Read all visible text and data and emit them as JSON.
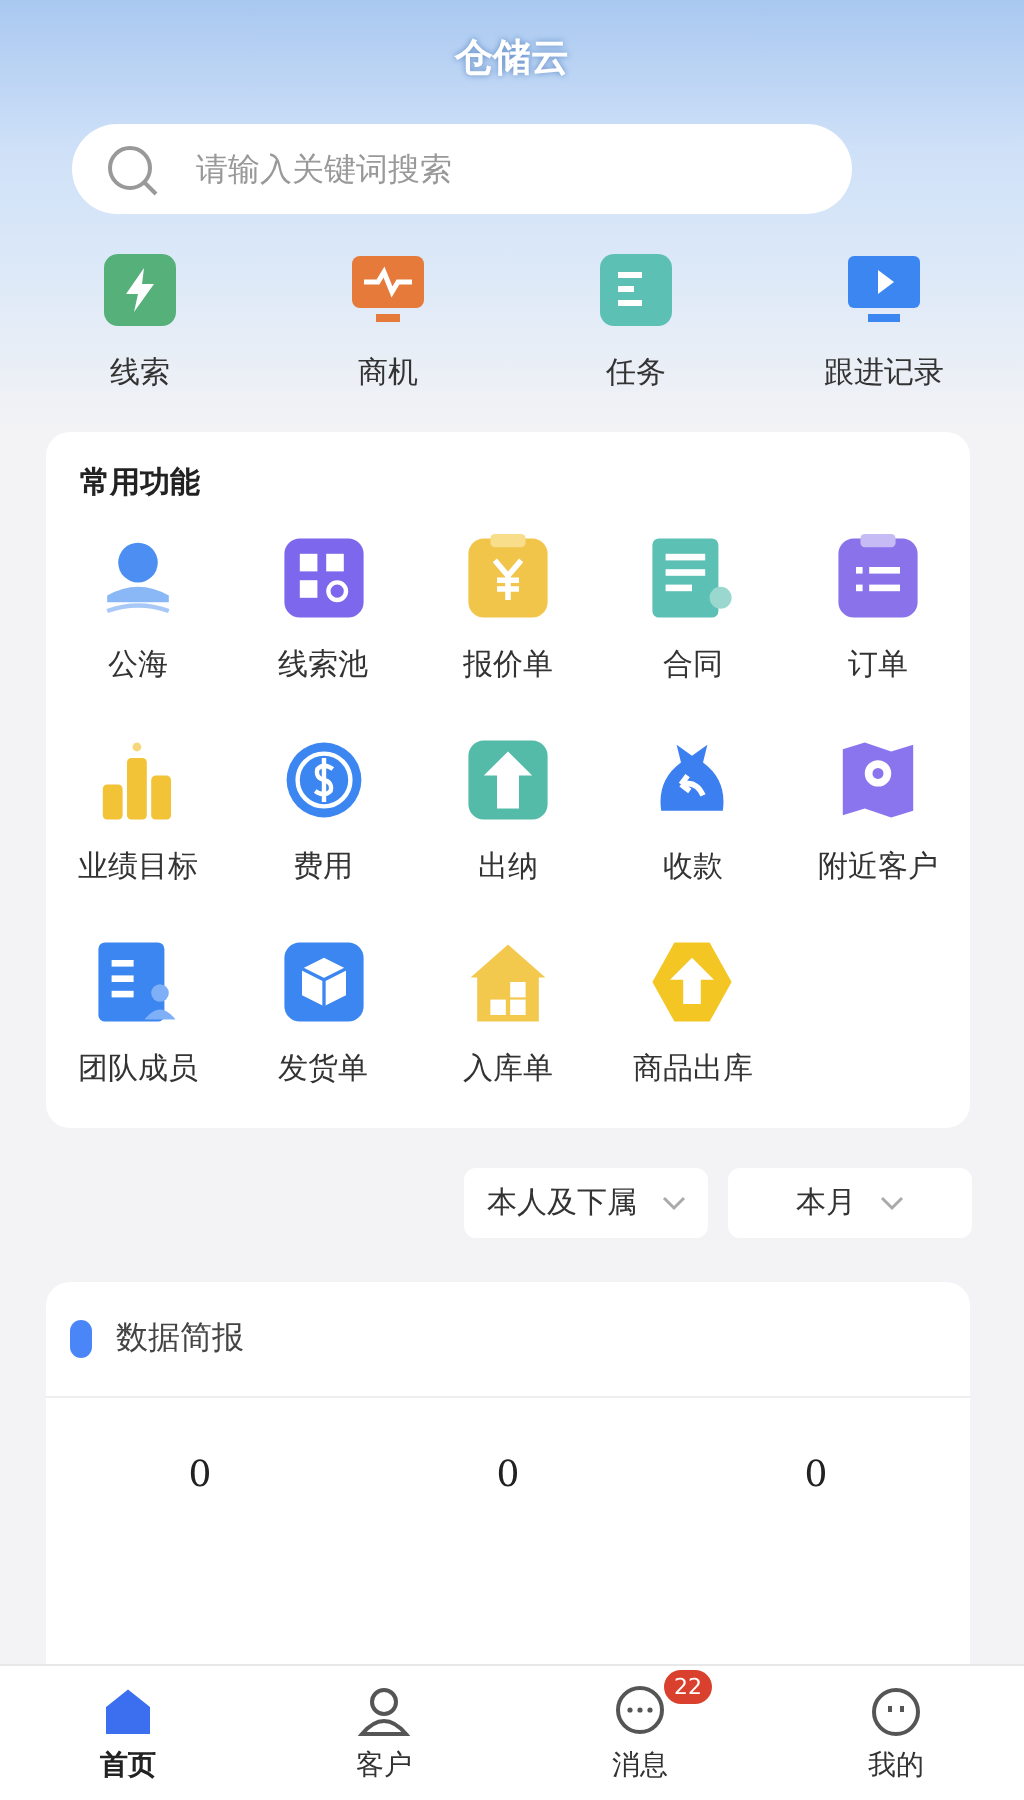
{
  "header": {
    "title": "仓储云"
  },
  "search": {
    "placeholder": "请输入关键词搜索"
  },
  "quick_links": [
    {
      "label": "线索"
    },
    {
      "label": "商机"
    },
    {
      "label": "任务"
    },
    {
      "label": "跟进记录"
    }
  ],
  "common_functions": {
    "title": "常用功能",
    "items": [
      {
        "label": "公海"
      },
      {
        "label": "线索池"
      },
      {
        "label": "报价单"
      },
      {
        "label": "合同"
      },
      {
        "label": "订单"
      },
      {
        "label": "业绩目标"
      },
      {
        "label": "费用"
      },
      {
        "label": "出纳"
      },
      {
        "label": "收款"
      },
      {
        "label": "附近客户"
      },
      {
        "label": "团队成员"
      },
      {
        "label": "发货单"
      },
      {
        "label": "入库单"
      },
      {
        "label": "商品出库"
      }
    ]
  },
  "filters": [
    {
      "label": "本人及下属"
    },
    {
      "label": "本月"
    }
  ],
  "data_report": {
    "title": "数据简报",
    "values": [
      "0",
      "0",
      "0"
    ]
  },
  "tab_bar": [
    {
      "label": "首页",
      "selected": true
    },
    {
      "label": "客户",
      "selected": false
    },
    {
      "label": "消息",
      "selected": false,
      "badge": "22"
    },
    {
      "label": "我的",
      "selected": false
    }
  ]
}
